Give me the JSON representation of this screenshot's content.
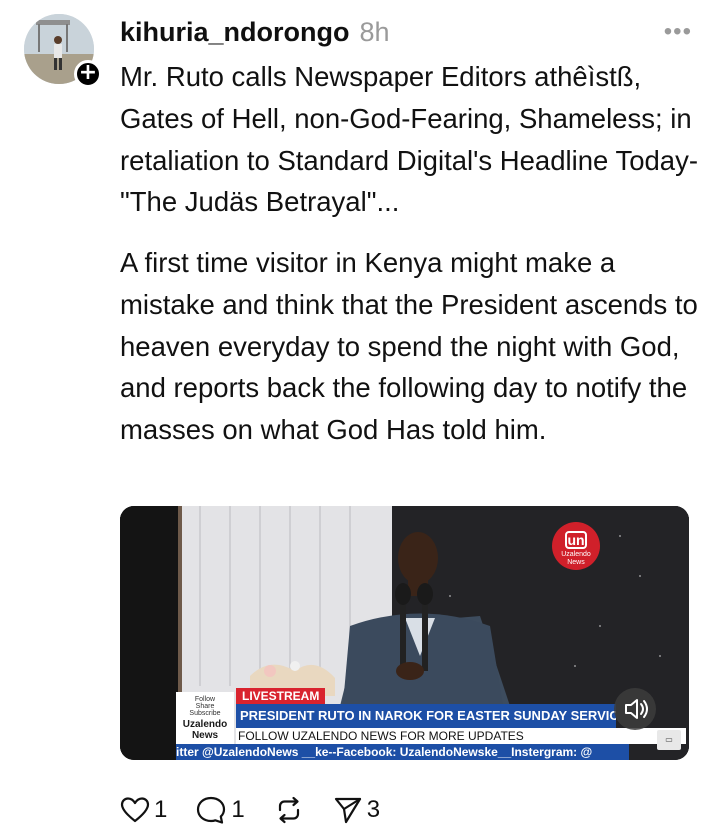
{
  "post": {
    "username": "kihuria_ndorongo",
    "time": "8h",
    "more_label": "•••",
    "paragraph1": "Mr. Ruto calls Newspaper Editors athêìstß, Gates of Hell, non-God-Fearing, Shameless; in retaliation to Standard Digital's Headline Today- \"The Judäs Betrayal\"...",
    "paragraph2": "A first time visitor in Kenya might make a mistake and think that the President ascends to heaven everyday to spend the night with God, and reports back the following day to notify the masses on what God Has told him."
  },
  "video": {
    "side_logo_lines": [
      "Follow",
      "Share",
      "Subscribe"
    ],
    "side_logo_brand": "Uzalendo News",
    "corner_logo_mark": "un",
    "corner_logo_name": "Uzalendo News",
    "livestream_label": "LIVESTREAM",
    "headline": "PRESIDENT RUTO IN NAROK FOR EASTER SUNDAY SERVICE",
    "follow_text": "FOLLOW UZALENDO NEWS FOR MORE UPDATES",
    "ticker": "itter @UzalendoNews __ke--Facebook: UzalendoNewske__Instergram: @"
  },
  "actions": {
    "likes": "1",
    "replies": "1",
    "shares": "3"
  },
  "icons": {
    "follow": "plus-icon",
    "mute": "speaker-icon",
    "like": "heart-icon",
    "reply": "comment-icon",
    "repost": "repost-icon",
    "share": "send-icon"
  }
}
